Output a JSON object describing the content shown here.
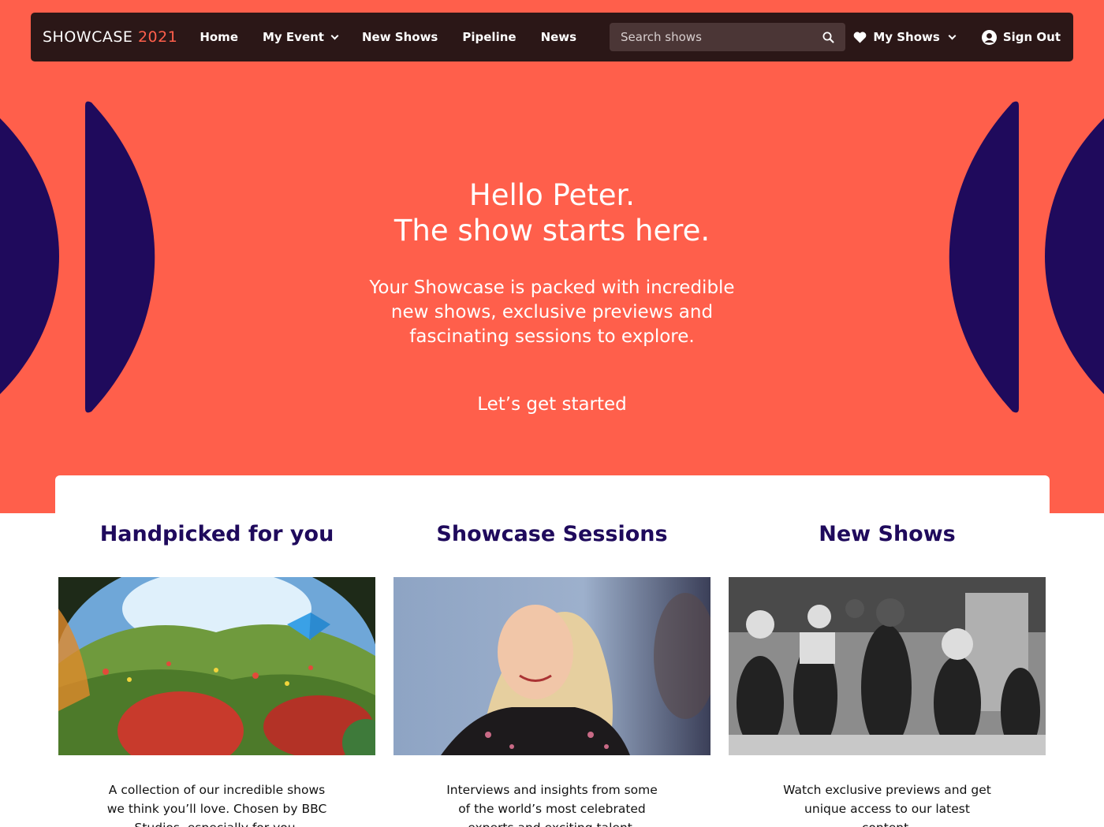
{
  "brand": {
    "name": "SHOWCASE",
    "year": "2021",
    "accent": "#ff5f4b"
  },
  "nav": {
    "items": [
      {
        "label": "Home",
        "dropdown": false
      },
      {
        "label": "My Event",
        "dropdown": true
      },
      {
        "label": "New Shows",
        "dropdown": false
      },
      {
        "label": "Pipeline",
        "dropdown": false
      },
      {
        "label": "News",
        "dropdown": false
      }
    ],
    "search_placeholder": "Search shows",
    "my_shows": "My Shows",
    "sign_out": "Sign Out"
  },
  "hero": {
    "title_line1": "Hello Peter.",
    "title_line2": "The show starts here.",
    "subtitle": "Your Showcase is packed with incredible new shows, exclusive previews and fascinating sessions to explore.",
    "cta": "Let’s get started",
    "background": "#ff5f4b",
    "shape_color": "#1f0a5c"
  },
  "cards": [
    {
      "title": "Handpicked for you",
      "image": "nature-butterfly-meadow",
      "description": "A collection of our incredible shows we think you’ll love. Chosen by BBC Studios, especially for you."
    },
    {
      "title": "Showcase Sessions",
      "image": "smiling-woman-portrait",
      "description": "Interviews and insights from some of the world’s most celebrated experts and exciting talent."
    },
    {
      "title": "New Shows",
      "image": "black-and-white-dancers",
      "description": "Watch exclusive previews and get unique access to our latest content."
    }
  ]
}
